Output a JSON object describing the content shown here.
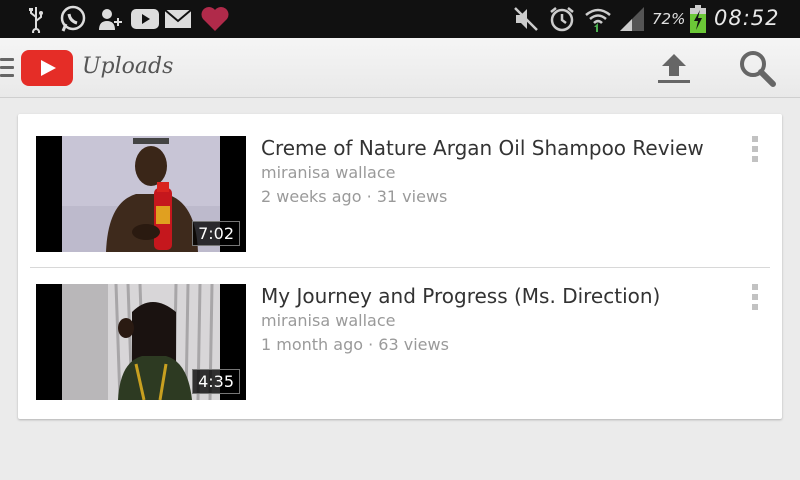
{
  "status_bar": {
    "icons_left": [
      "usb-icon",
      "whatsapp-icon",
      "add-contact-icon",
      "youtube-icon",
      "email-icon",
      "heart-icon"
    ],
    "icons_right": [
      "mute-icon",
      "alarm-icon",
      "wifi-icon",
      "signal-icon",
      "battery-charging-icon"
    ],
    "battery_percent": "72%",
    "time": "08:52"
  },
  "action_bar": {
    "title": "Uploads",
    "brand_color": "#e52d27"
  },
  "videos": [
    {
      "title": "Creme of Nature Argan Oil Shampoo Review",
      "channel": "miranisa wallace",
      "meta": "2 weeks ago · 31 views",
      "duration": "7:02"
    },
    {
      "title": "My Journey and Progress (Ms. Direction)",
      "channel": "miranisa wallace",
      "meta": "1 month ago · 63 views",
      "duration": "4:35"
    }
  ]
}
